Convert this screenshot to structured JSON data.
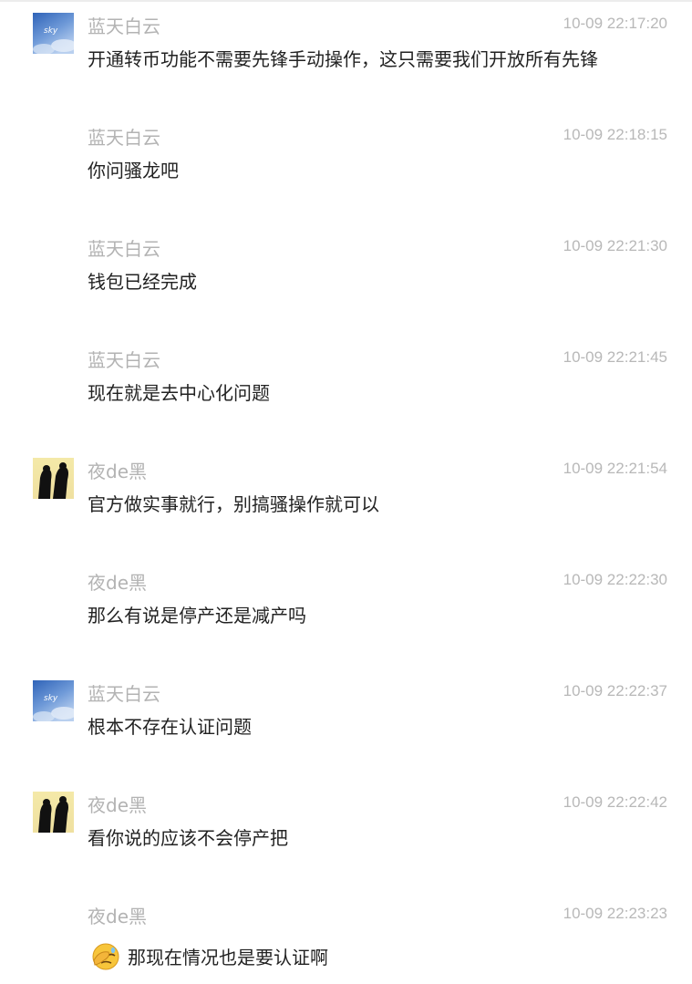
{
  "messages": [
    {
      "sender": "蓝天白云",
      "time": "10-09 22:17:20",
      "text": "开通转币功能不需要先锋手动操作，这只需要我们开放所有先锋",
      "avatar": "sky"
    },
    {
      "sender": "蓝天白云",
      "time": "10-09 22:18:15",
      "text": "你问骚龙吧",
      "avatar": ""
    },
    {
      "sender": "蓝天白云",
      "time": "10-09 22:21:30",
      "text": "钱包已经完成",
      "avatar": ""
    },
    {
      "sender": "蓝天白云",
      "time": "10-09 22:21:45",
      "text": "现在就是去中心化问题",
      "avatar": ""
    },
    {
      "sender": "夜de黑",
      "time": "10-09 22:21:54",
      "text": "官方做实事就行，别搞骚操作就可以",
      "avatar": "silhouette"
    },
    {
      "sender": "夜de黑",
      "time": "10-09 22:22:30",
      "text": "那么有说是停产还是减产吗",
      "avatar": ""
    },
    {
      "sender": "蓝天白云",
      "time": "10-09 22:22:37",
      "text": "根本不存在认证问题",
      "avatar": "sky"
    },
    {
      "sender": "夜de黑",
      "time": "10-09 22:22:42",
      "text": "看你说的应该不会停产把",
      "avatar": "silhouette"
    },
    {
      "sender": "夜de黑",
      "time": "10-09 22:23:23",
      "text": "那现在情况也是要认证啊",
      "avatar": "",
      "emoji": "facepalm-emoji"
    }
  ]
}
